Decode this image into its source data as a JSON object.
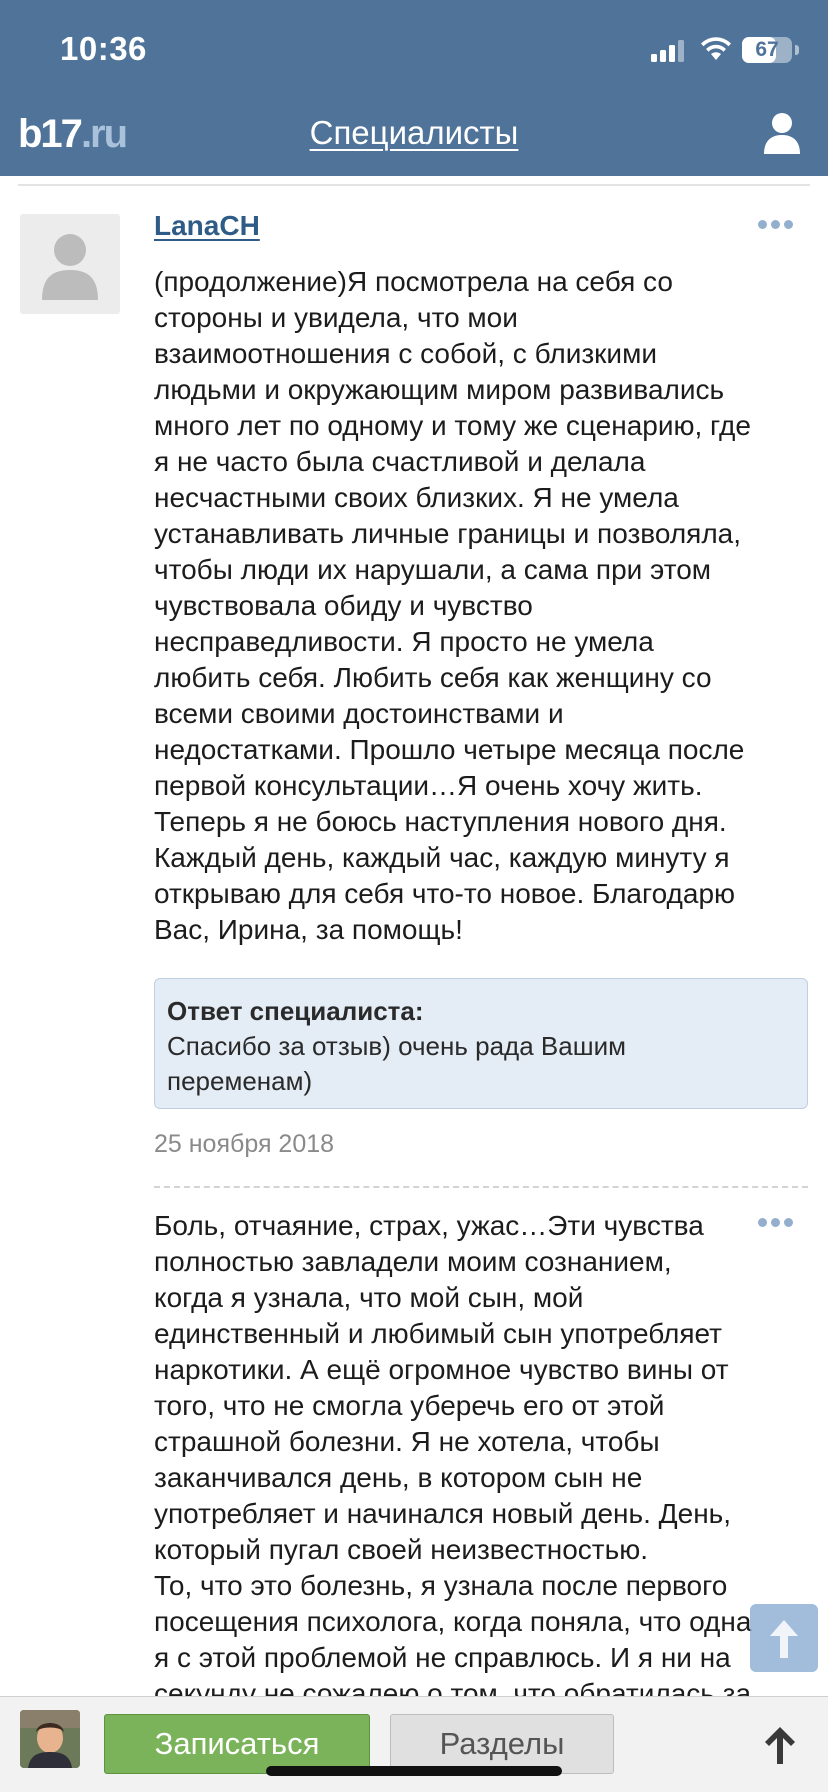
{
  "status_bar": {
    "time": "10:36",
    "battery": "67",
    "battery_level": 0.67
  },
  "header": {
    "logo_part1": "b17",
    "logo_part2": ".ru",
    "title": "Специалисты",
    "icons": [
      "profile-icon"
    ]
  },
  "review1": {
    "author": "LanaCH",
    "text": "(продолжение)Я посмотрела на себя со\nстороны и увидела, что мои\nвзаимоотношения с собой, с близкими\nлюдьми и окружающим миром развивались\nмного лет по одному и тому же сценарию, где\nя не часто была счастливой и делала\nнесчастными своих близких. Я не умела\nустанавливать личные границы и позволяла,\nчтобы люди их нарушали, а сама при этом\nчувствовала обиду и чувство\nнесправедливости. Я просто не умела\nлюбить себя. Любить себя как женщину со\nвсеми своими достоинствами и\nнедостатками. Прошло четыре месяца после\nпервой консультации…Я очень хочу жить.\nТеперь я не боюсь наступления нового дня.\nКаждый день, каждый час, каждую минуту я\nоткрываю для себя что-то новое. Благодарю\nВас, Ирина, за помощь!",
    "answer_title": "Ответ специалиста:",
    "answer_text": "Спасибо за отзыв) очень рада Вашим\nпеременам)",
    "date": "25 ноября 2018"
  },
  "review2": {
    "text": "Боль, отчаяние, страх, ужас…Эти чувства\nполностью завладели моим сознанием,\nкогда я узнала, что мой сын, мой\nединственный и любимый сын употребляет\nнаркотики. А ещё огромное чувство вины от\nтого, что не смогла уберечь его от этой\nстрашной болезни. Я не хотела, чтобы\nзаканчивался день, в котором сын не\nупотребляет и начинался новый день. День,\nкоторый пугал своей неизвестностью.\nТо, что это болезнь, я узнала после первого\nпосещения психолога, когда поняла, что одна\nя с этой проблемой не справлюсь. И я ни на\nсекунду не сожалею о том, что обратилась за"
  },
  "bottom_bar": {
    "signup_label": "Записаться",
    "sections_label": "Разделы"
  },
  "colors": {
    "header_bg": "#4f7399",
    "link": "#2f5c87",
    "signup_bg": "#7bb35a",
    "answer_bg": "#e4ecf5"
  }
}
